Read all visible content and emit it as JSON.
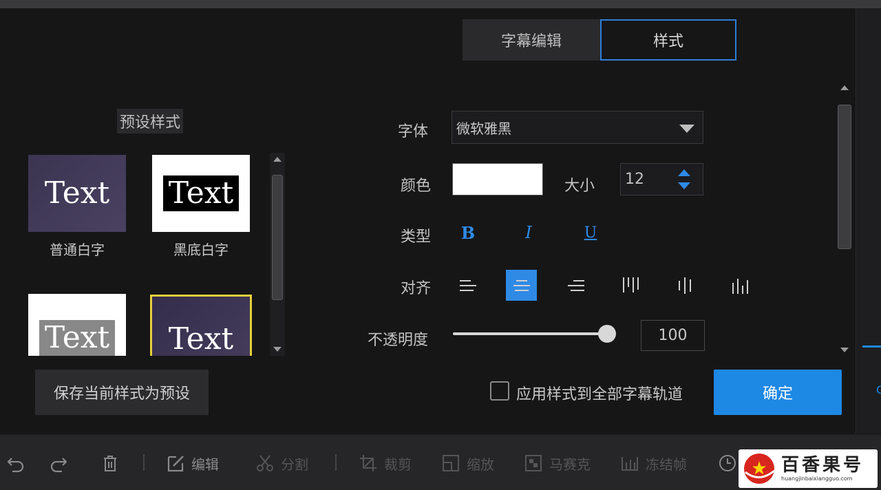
{
  "tabs": [
    {
      "label": "字幕编辑",
      "active": false
    },
    {
      "label": "样式",
      "active": true
    }
  ],
  "presets": {
    "title": "预设样式",
    "items": [
      {
        "thumb_text": "Text",
        "label": "普通白字"
      },
      {
        "thumb_text": "Text",
        "label": "黑底白字"
      },
      {
        "thumb_text": "Text",
        "label": ""
      },
      {
        "thumb_text": "Text",
        "label": ""
      }
    ]
  },
  "settings": {
    "font_label": "字体",
    "font_value": "微软雅黑",
    "color_label": "颜色",
    "color_value": "#ffffff",
    "size_label": "大小",
    "size_value": "12",
    "type_label": "类型",
    "bold_label": "B",
    "italic_label": "I",
    "underline_label": "U",
    "align_label": "对齐",
    "align_selected": "center",
    "opacity_label": "不透明度",
    "opacity_value": "100"
  },
  "actions": {
    "save_preset": "保存当前样式为预设",
    "apply_all": "应用样式到全部字幕轨道",
    "apply_all_checked": false,
    "confirm": "确定"
  },
  "toolbar": {
    "items": [
      {
        "icon": "undo-icon"
      },
      {
        "icon": "redo-icon"
      },
      {
        "icon": "delete-icon"
      },
      {
        "icon": "edit-icon",
        "label": "编辑"
      },
      {
        "icon": "split-icon",
        "label": "分割"
      },
      {
        "icon": "crop-icon",
        "label": "裁剪"
      },
      {
        "icon": "zoom-icon",
        "label": "缩放"
      },
      {
        "icon": "mosaic-icon",
        "label": "马赛克"
      },
      {
        "icon": "freeze-icon",
        "label": "冻结帧"
      },
      {
        "icon": "clock-icon"
      }
    ]
  },
  "right_edge_text": "C",
  "watermark": {
    "title": "百香果号",
    "url": "huangjinbaixiangguo.com"
  },
  "colors": {
    "accent": "#1e88e5",
    "selected_preset_border": "#e6cf3a"
  }
}
